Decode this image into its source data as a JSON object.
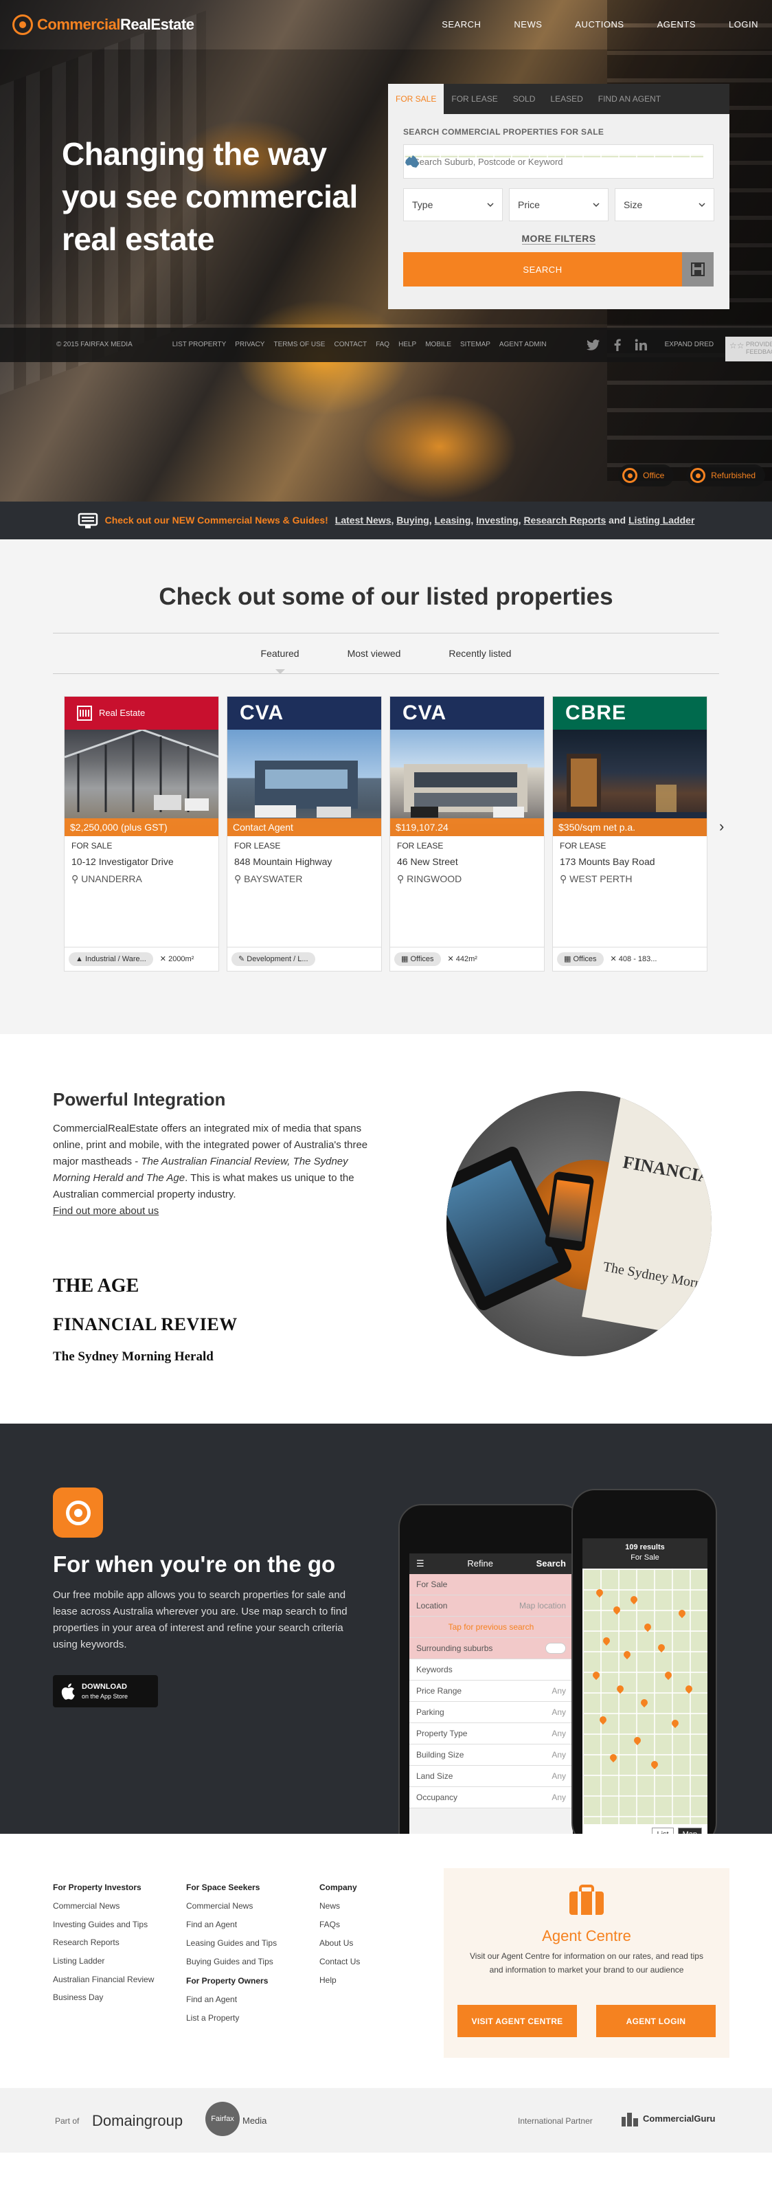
{
  "brand": {
    "part1": "Commercial",
    "part2": "RealEstate",
    "accent": "#f58220"
  },
  "nav": [
    "SEARCH",
    "NEWS",
    "AUCTIONS",
    "AGENTS",
    "LOGIN"
  ],
  "hero": {
    "title": "Changing the way you see commercial real estate",
    "tabs": [
      "FOR SALE",
      "FOR LEASE",
      "SOLD",
      "LEASED",
      "FIND AN AGENT"
    ],
    "search_heading": "SEARCH COMMERCIAL PROPERTIES FOR SALE",
    "search_placeholder": "Search Suburb, Postcode or Keyword",
    "filters": [
      "Type",
      "Price",
      "Size"
    ],
    "more_filters": "MORE FILTERS",
    "search_button": "SEARCH"
  },
  "footer_bar": {
    "copyright": "© 2015 FAIRFAX MEDIA",
    "links": [
      "LIST PROPERTY",
      "PRIVACY",
      "TERMS OF USE",
      "CONTACT",
      "FAQ",
      "HELP",
      "MOBILE",
      "SITEMAP",
      "AGENT ADMIN"
    ],
    "expand": "EXPAND DRED",
    "feedback_1": "PROVIDE",
    "feedback_2": "FEEDBACK"
  },
  "hero_tags": [
    "Office",
    "Refurbished"
  ],
  "news_bar": {
    "lead": "Check out our NEW Commercial News & Guides!",
    "links": [
      "Latest News",
      "Buying",
      "Leasing",
      "Investing",
      "Research Reports",
      "Listing Ladder"
    ]
  },
  "listings": {
    "title": "Check out some of our listed properties",
    "tabs": [
      "Featured",
      "Most viewed",
      "Recently listed"
    ],
    "cards": [
      {
        "brand": "Real Estate",
        "brand_color": "#c8102e",
        "price": "$2,250,000 (plus GST)",
        "status": "FOR SALE",
        "street": "10-12 Investigator Drive",
        "suburb": "UNANDERRA",
        "type": "Industrial / Ware...",
        "size": "2000m²"
      },
      {
        "brand": "CVA",
        "brand_color": "#1d2f5b",
        "price": "Contact Agent",
        "status": "FOR LEASE",
        "street": "848 Mountain Highway",
        "suburb": "BAYSWATER",
        "type": "Development / L...",
        "size": ""
      },
      {
        "brand": "CVA",
        "brand_color": "#1d2f5b",
        "price": "$119,107.24",
        "status": "FOR LEASE",
        "street": "46 New Street",
        "suburb": "RINGWOOD",
        "type": "Offices",
        "size": "442m²"
      },
      {
        "brand": "CBRE",
        "brand_color": "#006a4d",
        "price": "$350/sqm net p.a.",
        "status": "FOR LEASE",
        "street": "173 Mounts Bay Road",
        "suburb": "WEST PERTH",
        "type": "Offices",
        "size": "408 - 183..."
      }
    ]
  },
  "integration": {
    "title": "Powerful Integration",
    "body_1": "CommercialRealEstate offers an integrated mix of media that spans online, print and mobile, with the integrated power of Australia's three major mastheads - ",
    "body_em": "The Australian Financial Review, The Sydney Morning Herald and The Age",
    "body_2": ". This is what makes us unique to the Australian commercial property industry.",
    "link": "Find out more about us",
    "mastheads": [
      "THE AGE",
      "FINANCIAL REVIEW",
      "The Sydney Morning Herald"
    ]
  },
  "app": {
    "title": "For when you're on the go",
    "body": "Our free mobile app allows you to search properties for sale and lease across Australia wherever you are. Use map search to find properties in your area of interest and refine your search criteria using keywords.",
    "store_line1": "DOWNLOAD",
    "store_line2": "on the App Store",
    "refine": {
      "title": "Refine",
      "action": "Search",
      "rows": [
        {
          "label": "For Sale",
          "value": ""
        },
        {
          "label": "Location",
          "value": "Map location"
        },
        {
          "label": "Tap for previous search",
          "value": ""
        },
        {
          "label": "Surrounding suburbs",
          "value": ""
        },
        {
          "label": "Keywords",
          "value": ""
        },
        {
          "label": "Price Range",
          "value": "Any"
        },
        {
          "label": "Parking",
          "value": "Any"
        },
        {
          "label": "Property Type",
          "value": "Any"
        },
        {
          "label": "Building Size",
          "value": "Any"
        },
        {
          "label": "Land Size",
          "value": "Any"
        },
        {
          "label": "Occupancy",
          "value": "Any"
        }
      ]
    },
    "map_head": "109 results",
    "map_sub": "For Sale",
    "map_tabs": [
      "List",
      "Map"
    ]
  },
  "footer": {
    "columns": [
      {
        "heading": "For Property Investors",
        "links": [
          "Commercial News",
          "Investing Guides and Tips",
          "Research Reports",
          "Listing Ladder",
          "Australian Financial Review",
          "Business Day"
        ]
      },
      {
        "heading": "For Space Seekers",
        "links": [
          "Commercial News",
          "Find an Agent",
          "Leasing Guides and Tips",
          "Buying Guides and Tips"
        ],
        "heading2": "For Property Owners",
        "links2": [
          "Find an Agent",
          "List a Property"
        ]
      },
      {
        "heading": "Company",
        "links": [
          "News",
          "FAQs",
          "About Us",
          "Contact Us",
          "Help"
        ]
      }
    ],
    "agent_centre": {
      "title": "Agent Centre",
      "text": "Visit our Agent Centre for information on our rates, and read tips and information to market your brand to our audience",
      "visit_button": "VISIT AGENT CENTRE",
      "login_button": "AGENT LOGIN"
    }
  },
  "partners": {
    "part_of": "Part of",
    "domain": "Domaingroup",
    "fairfax": "Fairfax",
    "media": "Media",
    "international": "International Partner",
    "guru": "CommercialGuru"
  }
}
